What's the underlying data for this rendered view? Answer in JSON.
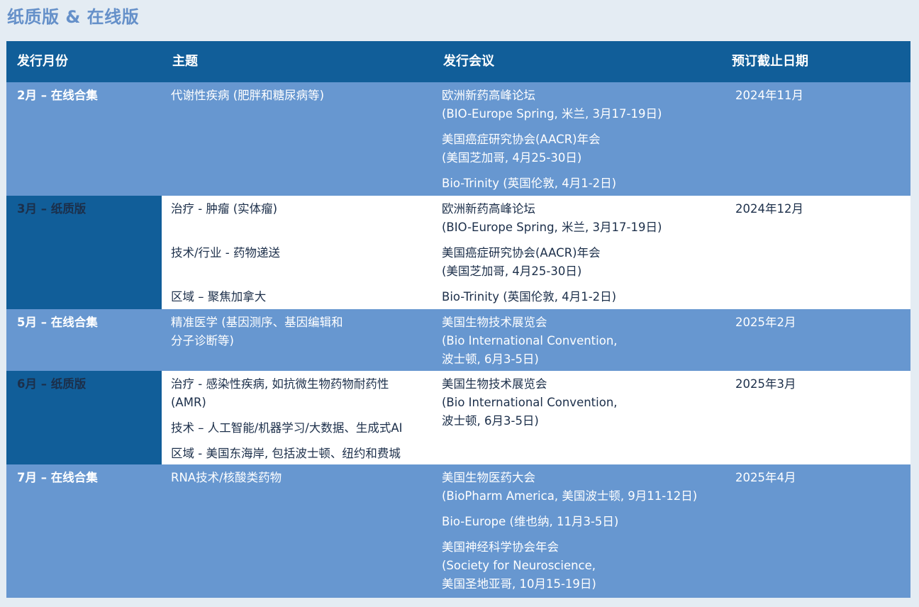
{
  "page_title": "纸质版 & 在线版",
  "headers": [
    "发行月份",
    "主题",
    "发行会议",
    "预订截止日期"
  ],
  "rows": [
    {
      "month": "2月 – 在线合集",
      "type": "online",
      "topics": [
        "代谢性疾病 (肥胖和糖尿病等)"
      ],
      "meetings": [
        [
          "欧洲新药高峰论坛",
          "(BIO-Europe Spring, 米兰, 3月17-19日)"
        ],
        [
          "美国癌症研究协会(AACR)年会",
          "(美国芝加哥, 4月25-30日)"
        ],
        [
          "Bio-Trinity (英国伦敦, 4月1-2日)"
        ]
      ],
      "deadline": "2024年11月"
    },
    {
      "month": "3月 – 纸质版",
      "type": "print",
      "topics": [
        "治疗 - 肿瘤 (实体瘤)",
        "技术/行业 - 药物递送",
        "区域 – 聚焦加拿大"
      ],
      "meetings": [
        [
          "欧洲新药高峰论坛",
          "(BIO-Europe Spring, 米兰, 3月17-19日)"
        ],
        [
          "美国癌症研究协会(AACR)年会",
          "(美国芝加哥, 4月25-30日)"
        ],
        [
          "Bio-Trinity (英国伦敦, 4月1-2日)"
        ]
      ],
      "deadline": "2024年12月"
    },
    {
      "month": "5月 – 在线合集",
      "type": "online",
      "topics": [
        "精准医学 (基因测序、基因编辑和",
        "分子诊断等)"
      ],
      "meetings": [
        [
          "美国生物技术展览会",
          "(Bio International Convention,",
          "波士顿, 6月3-5日)"
        ]
      ],
      "deadline": "2025年2月"
    },
    {
      "month": "6月 – 纸质版",
      "type": "print",
      "topics": [
        "治疗 - 感染性疾病, 如抗微生物药物耐药性",
        "(AMR)",
        "技术 – 人工智能/机器学习/大数据、生成式AI",
        "区域 - 美国东海岸, 包括波士顿、纽约和费城"
      ],
      "meetings": [
        [
          "美国生物技术展览会",
          "(Bio International Convention,",
          "波士顿, 6月3-5日)"
        ]
      ],
      "deadline": "2025年3月"
    },
    {
      "month": "7月 – 在线合集",
      "type": "online",
      "topics": [
        "RNA技术/核酸类药物"
      ],
      "meetings": [
        [
          "美国生物医药大会",
          "(BioPharm America, 美国波士顿, 9月11-12日)"
        ],
        [
          "Bio-Europe (维也纳, 11月3-5日)"
        ],
        [
          "美国神经科学协会年会",
          "(Society for Neuroscience,",
          "美国圣地亚哥, 10月15-19日)"
        ]
      ],
      "deadline": "2025年4月"
    }
  ]
}
